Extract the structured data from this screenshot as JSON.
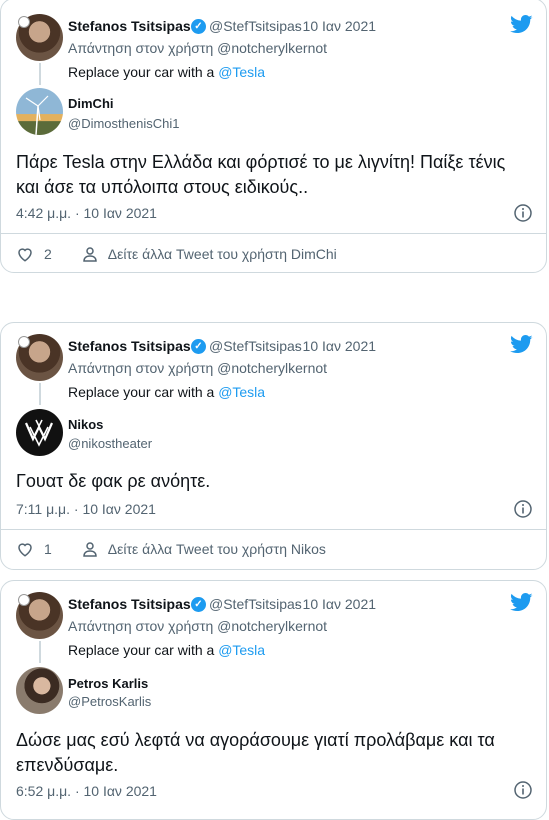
{
  "tweets": [
    {
      "author_name": "Stefanos Tsitsipas",
      "author_handle": "@StefTsitsipas",
      "date": "· 10 Ιαν 2021",
      "reply_to": "Απάντηση στον χρήστη @notcherylkernot",
      "quote_prefix": "Replace your car with a ",
      "quote_link": "@Tesla",
      "reply_name": "DimChi",
      "reply_handle": "@DimosthenisChi1",
      "reply_text": "Πάρε Tesla στην Ελλάδα και φόρτισέ το με λιγνίτη! Παίξε τένις και άσε τα υπόλοιπα στους ειδικούς..",
      "timestamp": "4:42 μ.μ. · 10 Ιαν 2021",
      "likes": "2",
      "more_tweets": "Δείτε άλλα Tweet του χρήστη DimChi"
    },
    {
      "author_name": "Stefanos Tsitsipas",
      "author_handle": "@StefTsitsipas",
      "date": "· 10 Ιαν 2021",
      "reply_to": "Απάντηση στον χρήστη @notcherylkernot",
      "quote_prefix": "Replace your car with a ",
      "quote_link": "@Tesla",
      "reply_name": "Nikos",
      "reply_handle": "@nikostheater",
      "reply_text": "Γουατ δε φακ ρε ανόητε.",
      "timestamp": "7:11 μ.μ. · 10 Ιαν 2021",
      "likes": "1",
      "more_tweets": "Δείτε άλλα Tweet του χρήστη Nikos"
    },
    {
      "author_name": "Stefanos Tsitsipas",
      "author_handle": "@StefTsitsipas",
      "date": "· 10 Ιαν 2021",
      "reply_to": "Απάντηση στον χρήστη @notcherylkernot",
      "quote_prefix": "Replace your car with a ",
      "quote_link": "@Tesla",
      "reply_name": "Petros Karlis",
      "reply_handle": "@PetrosKarlis",
      "reply_text": "Δώσε μας εσύ λεφτά να αγοράσουμε γιατί προλάβαμε και τα επενδύσαμε.",
      "timestamp": "6:52 μ.μ. · 10 Ιαν 2021"
    }
  ],
  "colors": {
    "accent": "#1d9bf0",
    "muted": "#536471",
    "border": "#cfd9de"
  },
  "icons": [
    "verified-badge-icon",
    "twitter-bird-icon",
    "info-icon",
    "heart-icon",
    "person-icon"
  ]
}
